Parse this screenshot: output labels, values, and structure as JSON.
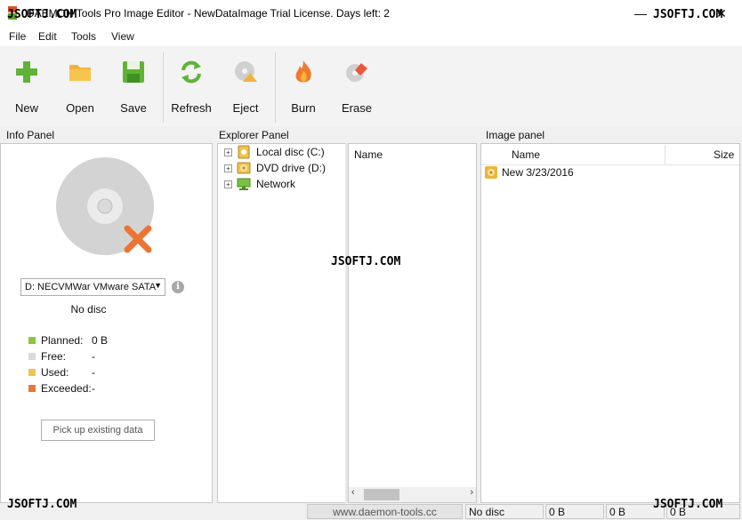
{
  "window": {
    "title": "DAEMON Tools Pro Image Editor - NewDataImage  Trial License. Days left: 2",
    "minimize_glyph": "—",
    "close_glyph": "✕"
  },
  "watermark": "JSOFTJ.COM",
  "menu": [
    {
      "label": "File"
    },
    {
      "label": "Edit"
    },
    {
      "label": "Tools"
    },
    {
      "label": "View"
    }
  ],
  "toolbar": {
    "new": "New",
    "open": "Open",
    "save": "Save",
    "refresh": "Refresh",
    "eject": "Eject",
    "burn": "Burn",
    "erase": "Erase"
  },
  "info_panel": {
    "title": "Info Panel",
    "drive": "D: NECVMWar VMware SATA",
    "status": "No disc",
    "stats": [
      {
        "label": "Planned:",
        "value": "0 B",
        "color": "#8cc63f"
      },
      {
        "label": "Free:",
        "value": "-",
        "color": "#d9d9d9"
      },
      {
        "label": "Used:",
        "value": "-",
        "color": "#f2c14e"
      },
      {
        "label": "Exceeded:",
        "value": "-",
        "color": "#e8773a"
      }
    ],
    "pickup_button": "Pick up existing data"
  },
  "explorer_panel": {
    "title": "Explorer Panel",
    "tree": [
      {
        "label": "Local disc (C:)",
        "icon": "local-disc-icon"
      },
      {
        "label": "DVD drive (D:)",
        "icon": "dvd-drive-icon"
      },
      {
        "label": "Network",
        "icon": "network-icon"
      }
    ],
    "column_name": "Name"
  },
  "image_panel": {
    "title": "Image panel",
    "column_name": "Name",
    "column_size": "Size",
    "items": [
      {
        "label": "New 3/23/2016",
        "size": ""
      }
    ]
  },
  "statusbar": {
    "site": "www.daemon-tools.cc",
    "disc": "No disc",
    "v1": "0 B",
    "v2": "0 B",
    "v3": "0 B"
  }
}
